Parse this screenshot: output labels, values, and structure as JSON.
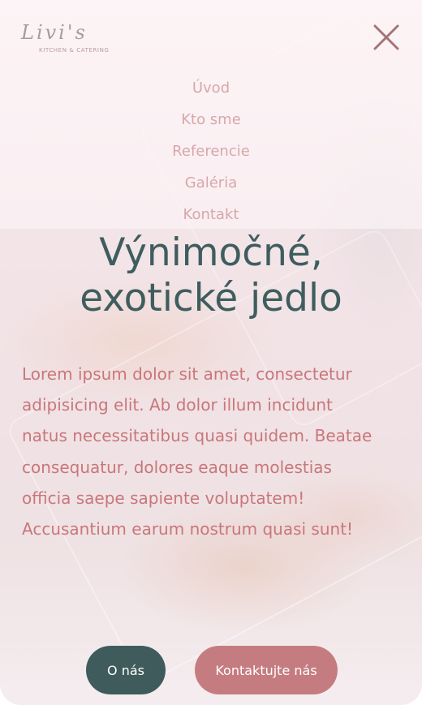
{
  "brand": {
    "logo_script": "Livi's",
    "logo_sub": "KITCHEN & CATERING"
  },
  "menu": {
    "close_icon": "close-x-icon",
    "items": [
      {
        "label": "Úvod"
      },
      {
        "label": "Kto sme"
      },
      {
        "label": "Referencie"
      },
      {
        "label": "Galéria"
      },
      {
        "label": "Kontakt"
      }
    ]
  },
  "hero": {
    "title_line1": "Výnimočné,",
    "title_line2": "exotické jedlo",
    "text": "Lorem ipsum dolor sit amet, consectetur adipisicing elit. Ab dolor illum incidunt natus necessitatibus quasi quidem. Beatae consequatur, dolores eaque molestias officia saepe sapiente voluptatem! Accusantium earum nostrum quasi sunt!"
  },
  "buttons": {
    "about": "O nás",
    "contact": "Kontaktujte nás"
  },
  "colors": {
    "teal": "#3f5b5c",
    "rose": "#c57c80",
    "nav_pink": "#d7a7aa",
    "text_rose": "#c9767b"
  }
}
